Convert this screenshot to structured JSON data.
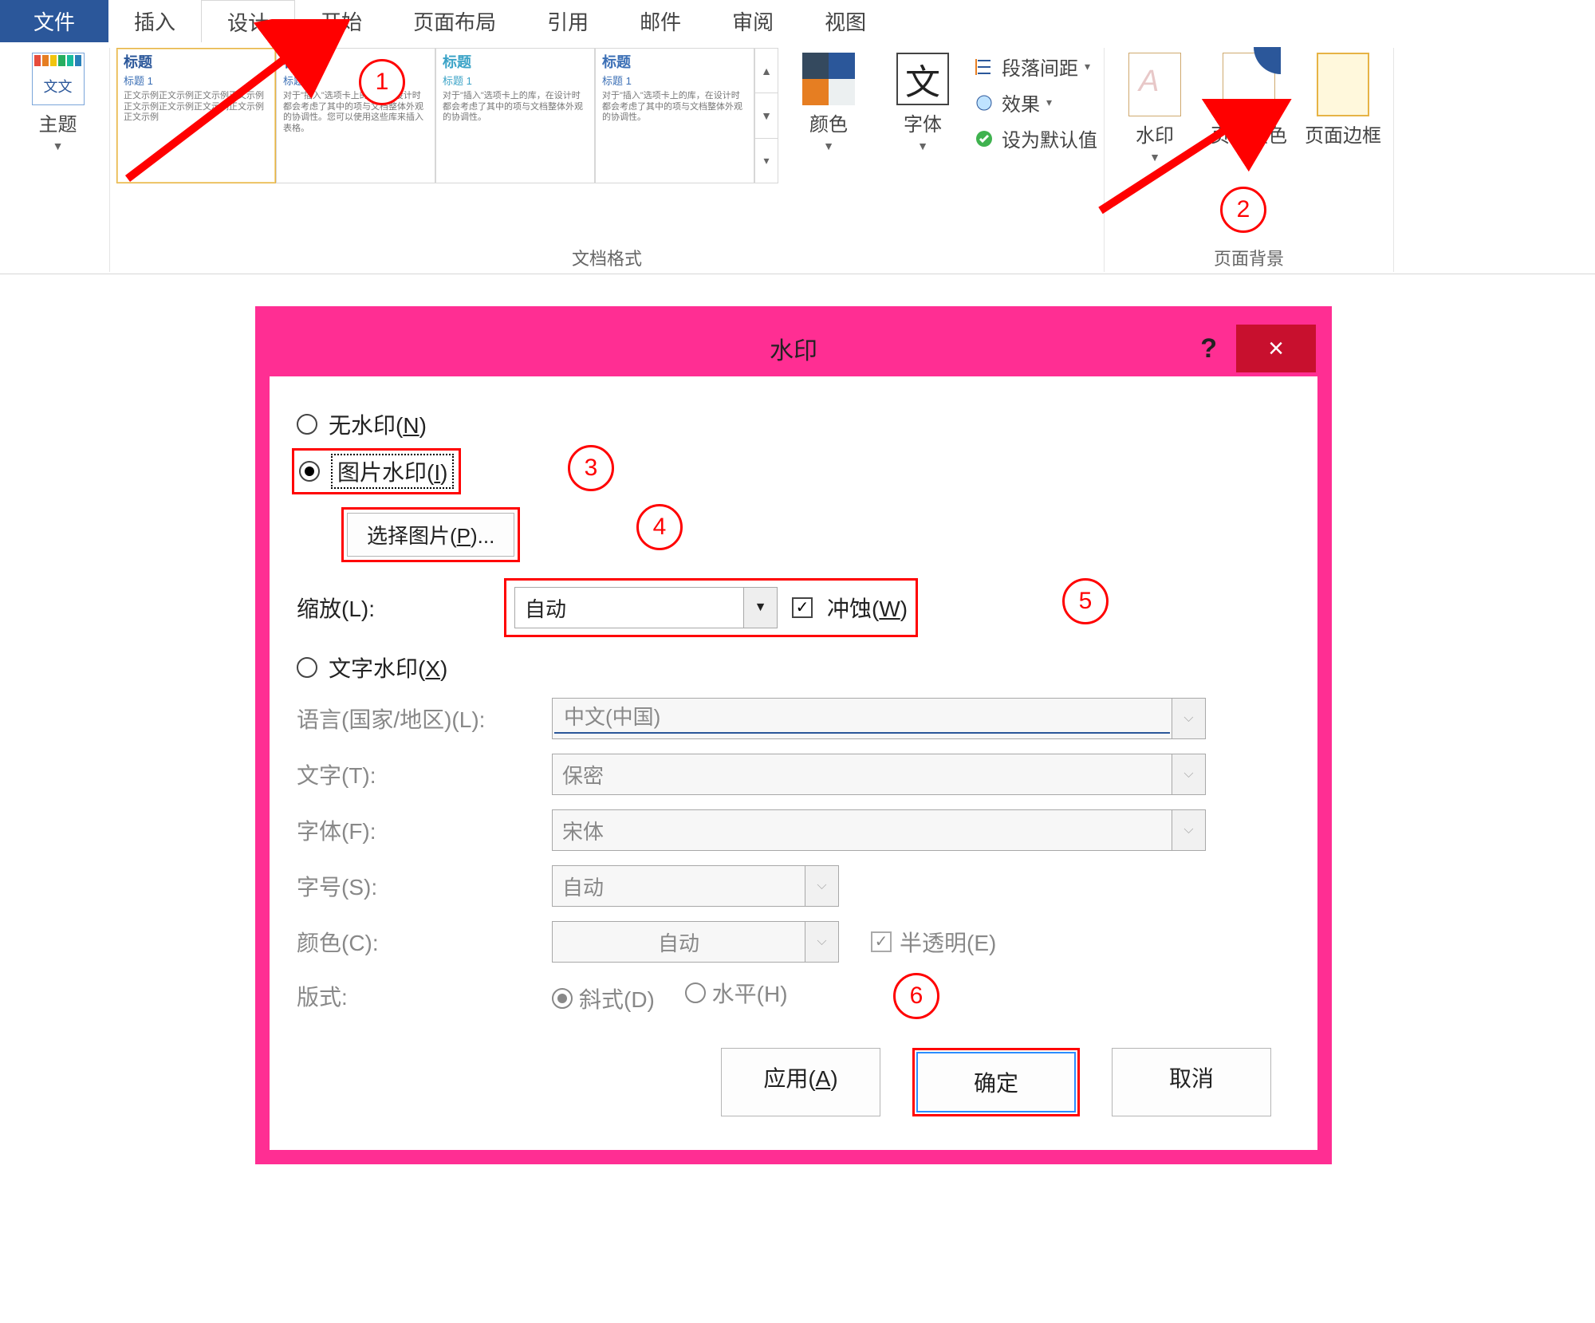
{
  "ribbon": {
    "tabs": {
      "file": "文件",
      "insert": "插入",
      "design": "设计",
      "home": "开始",
      "layout": "页面布局",
      "references": "引用",
      "mailings": "邮件",
      "review": "审阅",
      "view": "视图"
    },
    "groups": {
      "themes_label": "主题",
      "doc_format_label": "文档格式",
      "page_background_label": "页面背景"
    },
    "buttons": {
      "themes": "主题",
      "colors": "颜色",
      "fonts": "字体",
      "paragraph_spacing": "段落间距",
      "effects": "效果",
      "set_default": "设为默认值",
      "watermark": "水印",
      "page_color": "页面颜色",
      "page_borders": "页面边框"
    },
    "gallery": {
      "item_title": "标题",
      "item_sub": "标题 1"
    },
    "font_glyph": "文"
  },
  "annotations": {
    "b1": "1",
    "b2": "2",
    "b3": "3",
    "b4": "4",
    "b5": "5",
    "b6": "6"
  },
  "dialog": {
    "title": "水印",
    "help": "?",
    "close": "×",
    "no_watermark": "无水印(",
    "no_watermark_key": "N",
    "pic_watermark": "图片水印(",
    "pic_watermark_key": "I",
    "select_picture": "选择图片(",
    "select_picture_key": "P",
    "select_picture_tail": ")...",
    "scale_label": "缩放(L):",
    "scale_value": "自动",
    "washout": "冲蚀(",
    "washout_key": "W",
    "text_watermark": "文字水印(",
    "text_watermark_key": "X",
    "language_label": "语言(国家/地区)(L):",
    "language_value": "中文(中国)",
    "text_label": "文字(T):",
    "text_value": "保密",
    "font_label": "字体(F):",
    "font_value": "宋体",
    "size_label": "字号(S):",
    "size_value": "自动",
    "color_label": "颜色(C):",
    "color_value": "自动",
    "semitrans": "半透明(E)",
    "layout_label": "版式:",
    "layout_diag": "斜式(D)",
    "layout_horiz": "水平(H)",
    "apply": "应用(",
    "apply_key": "A",
    "ok": "确定",
    "cancel": "取消",
    "paren_close": ")"
  }
}
